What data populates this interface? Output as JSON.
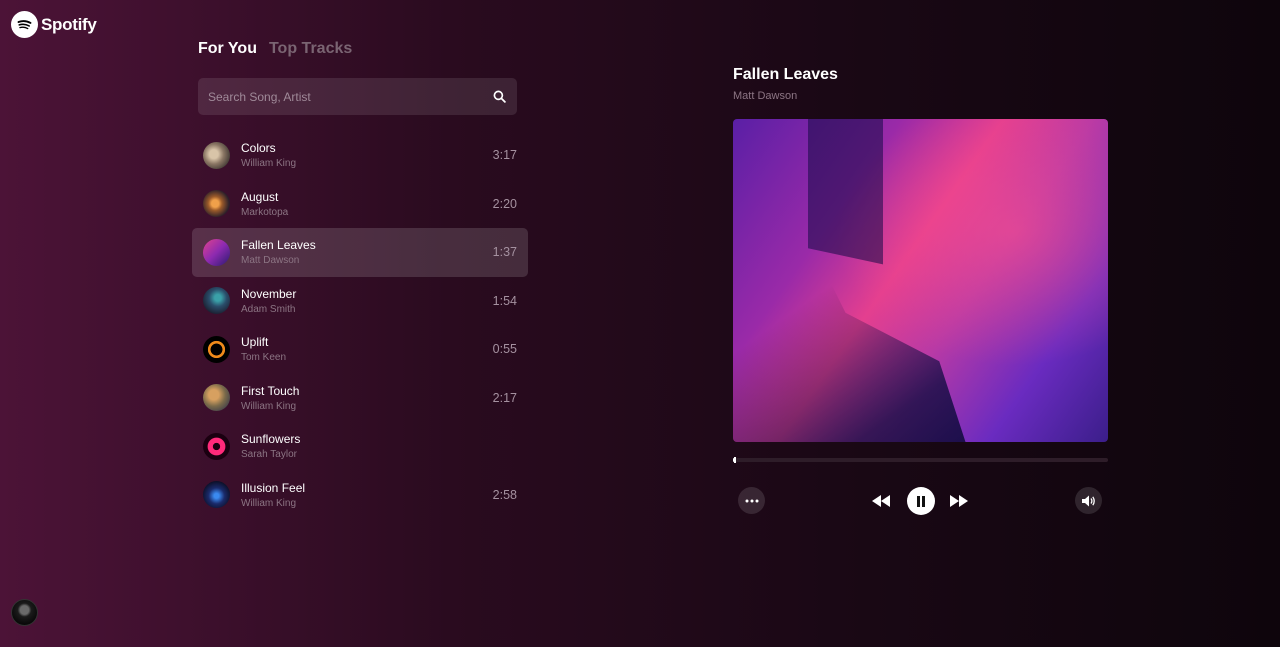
{
  "brand": {
    "name": "Spotify"
  },
  "tabs": [
    {
      "label": "For You",
      "active": true
    },
    {
      "label": "Top Tracks",
      "active": false
    }
  ],
  "search": {
    "placeholder": "Search Song, Artist",
    "value": ""
  },
  "tracks": [
    {
      "title": "Colors",
      "artist": "William King",
      "duration": "3:17",
      "cover": "colors-cover"
    },
    {
      "title": "August",
      "artist": "Markotopa",
      "duration": "2:20",
      "cover": "august-cover"
    },
    {
      "title": "Fallen Leaves",
      "artist": "Matt Dawson",
      "duration": "1:37",
      "cover": "fallen-leaves-cover",
      "selected": true
    },
    {
      "title": "November",
      "artist": "Adam Smith",
      "duration": "1:54",
      "cover": "november-cover"
    },
    {
      "title": "Uplift",
      "artist": "Tom Keen",
      "duration": "0:55",
      "cover": "uplift-cover"
    },
    {
      "title": "First Touch",
      "artist": "William King",
      "duration": "2:17",
      "cover": "first-touch-cover"
    },
    {
      "title": "Sunflowers",
      "artist": "Sarah Taylor",
      "duration": "",
      "cover": "sunflowers-cover"
    },
    {
      "title": "Illusion Feel",
      "artist": "William King",
      "duration": "2:58",
      "cover": "illusion-feel-cover"
    }
  ],
  "now_playing": {
    "title": "Fallen Leaves",
    "artist": "Matt Dawson",
    "progress": 0.005,
    "is_playing": true
  },
  "controls": {
    "more_icon": "more-dots-icon",
    "prev_icon": "rewind-icon",
    "play_pause_icon": "pause-icon",
    "next_icon": "fast-forward-icon",
    "volume_icon": "volume-icon"
  },
  "colors": {
    "accent": "#ffffff",
    "muted_text": "#8c7584",
    "inactive_tab": "#7a6472"
  }
}
